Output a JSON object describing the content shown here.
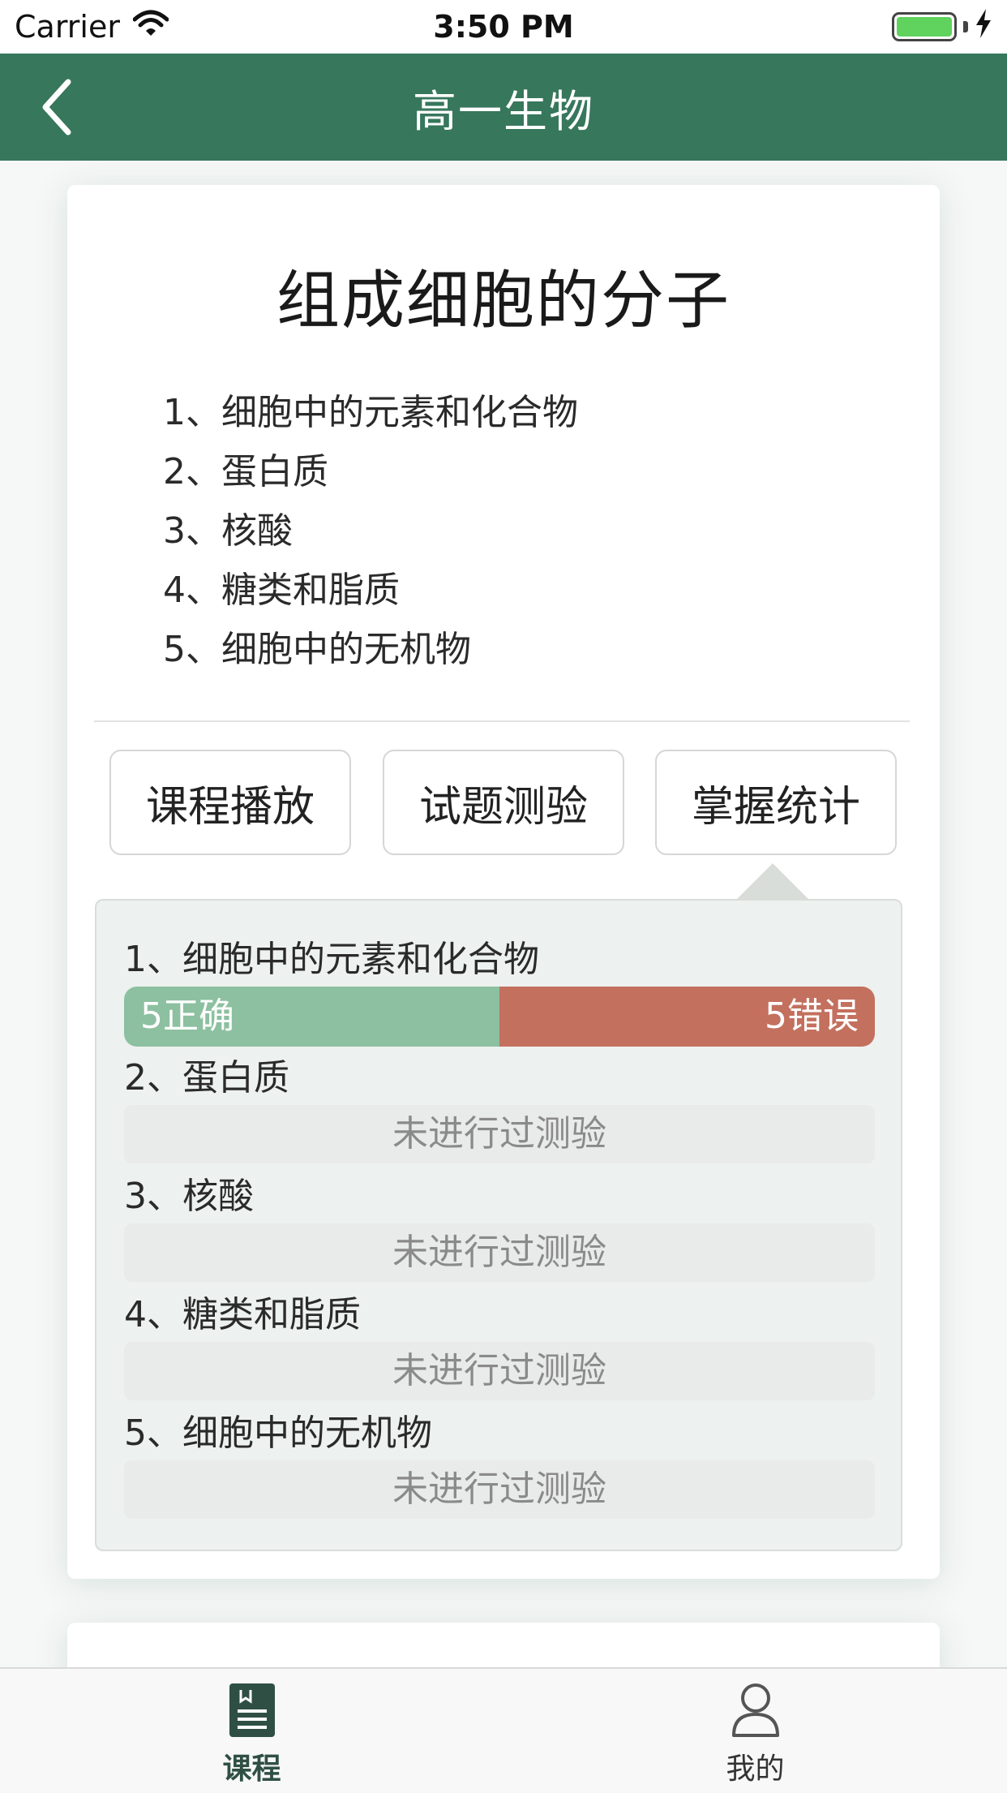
{
  "status_bar": {
    "carrier": "Carrier",
    "time": "3:50 PM"
  },
  "nav": {
    "title": "高一生物"
  },
  "chapter": {
    "title": "组成细胞的分子",
    "topics": [
      "1、细胞中的元素和化合物",
      "2、蛋白质",
      "3、核酸",
      "4、糖类和脂质",
      "5、细胞中的无机物"
    ]
  },
  "actions": {
    "play": "课程播放",
    "quiz": "试题测验",
    "stats": "掌握统计"
  },
  "stats": [
    {
      "label": "1、细胞中的元素和化合物",
      "correct_text": "5正确",
      "wrong_text": "5错误",
      "correct_fraction": 0.5
    },
    {
      "label": "2、蛋白质",
      "empty_text": "未进行过测验"
    },
    {
      "label": "3、核酸",
      "empty_text": "未进行过测验"
    },
    {
      "label": "4、糖类和脂质",
      "empty_text": "未进行过测验"
    },
    {
      "label": "5、细胞中的无机物",
      "empty_text": "未进行过测验"
    }
  ],
  "tabs": {
    "course": "课程",
    "mine": "我的"
  },
  "colors": {
    "nav": "#37775c",
    "correct": "#8cc0a0",
    "wrong": "#c4705e"
  }
}
